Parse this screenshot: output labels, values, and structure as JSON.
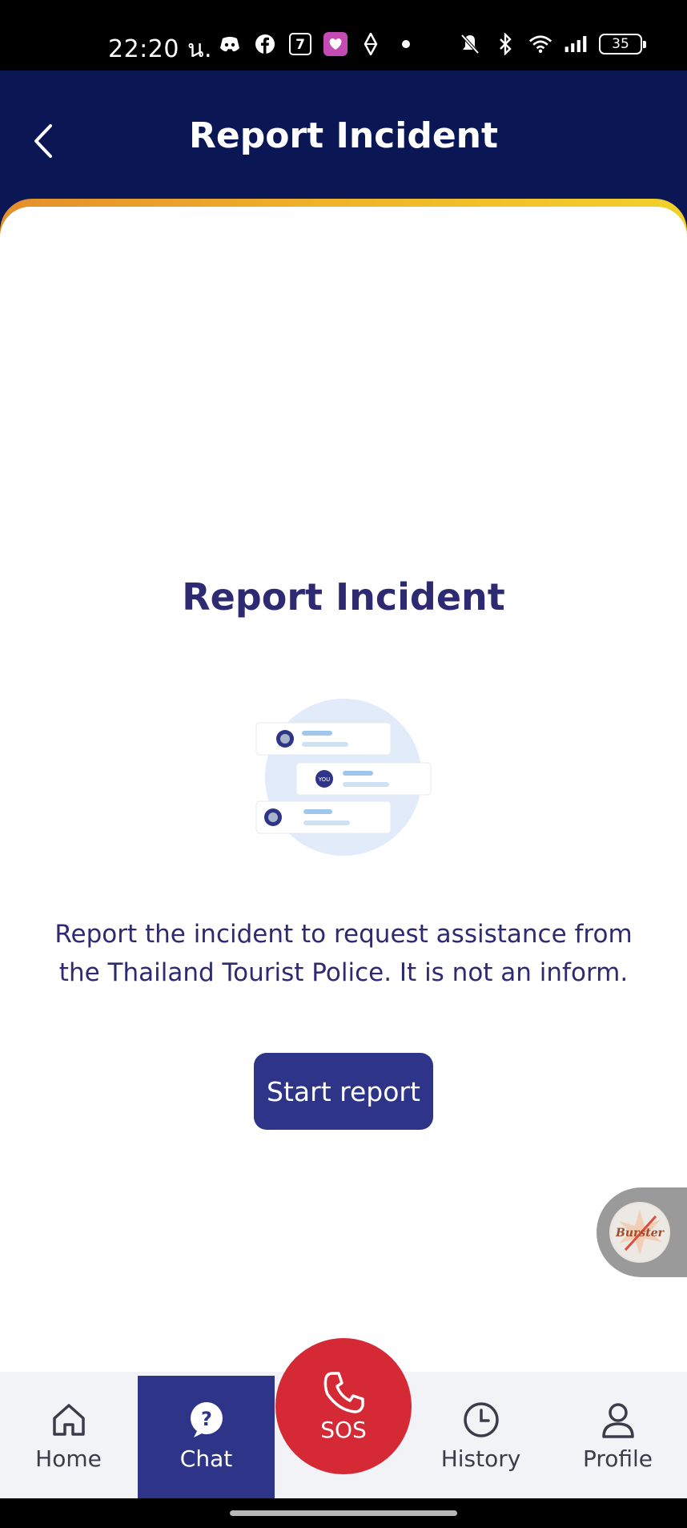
{
  "status_bar": {
    "time": "22:20 น.",
    "battery": "35",
    "left_icons": [
      "discord-icon",
      "facebook-icon",
      "seven-eleven-icon",
      "lazada-icon",
      "diamond-icon",
      "dot-icon"
    ],
    "right_icons": [
      "mute-icon",
      "bluetooth-icon",
      "wifi-icon",
      "signal-icon",
      "battery-icon"
    ]
  },
  "header": {
    "title": "Report Incident",
    "back_icon": "chevron-left-icon"
  },
  "main": {
    "title": "Report Incident",
    "illustration": {
      "icon": "chat-bubbles-illustration",
      "you_label": "YOU"
    },
    "description": "Report the incident to request assistance from the Thailand Tourist Police. It is not an inform.",
    "start_button": "Start report"
  },
  "floating_widget": {
    "label": "Burster",
    "icon": "burster-app-icon"
  },
  "bottom_nav": {
    "items": [
      {
        "label": "Home",
        "icon": "home-icon"
      },
      {
        "label": "Chat",
        "icon": "question-circle-icon"
      },
      {
        "label": "History",
        "icon": "clock-icon"
      },
      {
        "label": "Profile",
        "icon": "user-icon"
      }
    ],
    "sos_label": "SOS",
    "sos_icon": "phone-icon"
  },
  "colors": {
    "header_bg": "#0b1655",
    "accent": "#2e3589",
    "title_text": "#2e2a72",
    "sos": "#d52a36",
    "band_start": "#e48f2b",
    "band_end": "#f2d12b"
  }
}
